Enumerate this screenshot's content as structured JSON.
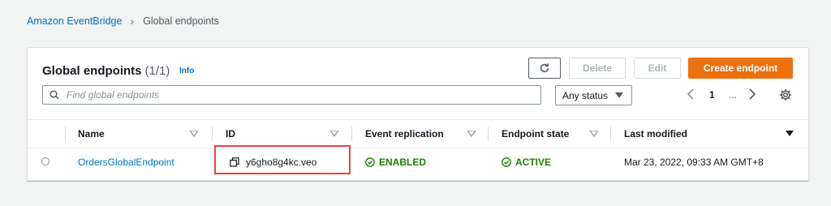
{
  "breadcrumb": {
    "root": "Amazon EventBridge",
    "current": "Global endpoints"
  },
  "panel": {
    "title": "Global endpoints",
    "count": "(1/1)",
    "info": "Info"
  },
  "actions": {
    "refresh_icon": "refresh-icon",
    "delete": "Delete",
    "edit": "Edit",
    "create": "Create endpoint"
  },
  "filter": {
    "search_placeholder": "Find global endpoints",
    "status": "Any status"
  },
  "pagination": {
    "current_page": "1",
    "ellipsis": "..."
  },
  "table": {
    "columns": [
      "Name",
      "ID",
      "Event replication",
      "Endpoint state",
      "Last modified"
    ],
    "rows": [
      {
        "name": "OrdersGlobalEndpoint",
        "id": "y6gho8g4kc.veo",
        "event_replication": "ENABLED",
        "endpoint_state": "ACTIVE",
        "last_modified": "Mar 23, 2022, 09:33 AM GMT+8"
      }
    ]
  },
  "colors": {
    "primary": "#ec7211",
    "link": "#0073bb",
    "success": "#1d8102",
    "highlight": "#e8473f"
  }
}
